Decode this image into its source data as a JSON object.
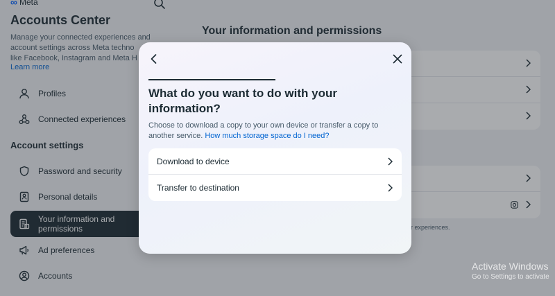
{
  "background": {
    "brand": "Meta",
    "title": "Accounts Center",
    "description_lines": [
      "Manage your connected experiences and",
      "account settings across Meta techno",
      "like Facebook, Instagram and Meta H"
    ],
    "learn_more": "Learn more",
    "nav_top": [
      {
        "label": "Profiles",
        "icon": "person-icon"
      },
      {
        "label": "Connected experiences",
        "icon": "connected-icon"
      }
    ],
    "section_heading": "Account settings",
    "nav_settings": [
      {
        "label": "Password and security",
        "icon": "shield-icon"
      },
      {
        "label": "Personal details",
        "icon": "id-card-icon"
      },
      {
        "label": "Your information and permissions",
        "icon": "info-doc-icon",
        "active": true
      },
      {
        "label": "Ad preferences",
        "icon": "megaphone-icon"
      },
      {
        "label": "Accounts",
        "icon": "account-circle-icon"
      }
    ],
    "main_title": "Your information and permissions",
    "main_note": "r experiences."
  },
  "modal": {
    "title": "What do you want to do with your information?",
    "description": "Choose to download a copy to your own device or transfer a copy to another service.",
    "link": "How much storage space do I need?",
    "options": [
      {
        "label": "Download to device"
      },
      {
        "label": "Transfer to destination"
      }
    ],
    "progress": 0.5
  },
  "watermark": {
    "title": "Activate Windows",
    "subtitle": "Go to Settings to activate"
  },
  "colors": {
    "accent": "#0064d1",
    "active_nav": "#1c2b33",
    "text": "#1c2b33"
  }
}
